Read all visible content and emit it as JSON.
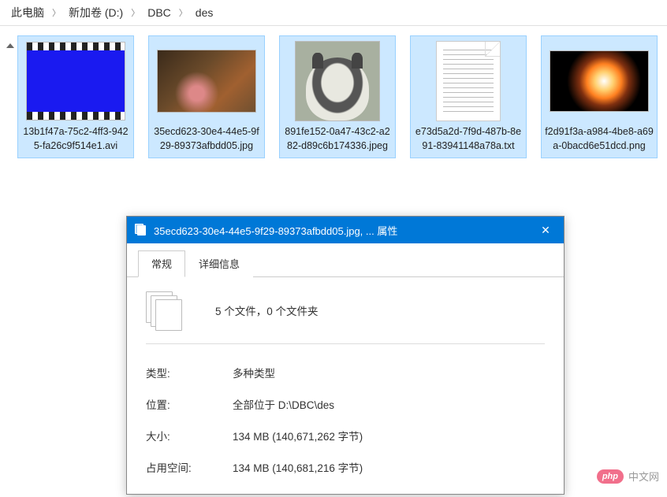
{
  "breadcrumb": {
    "items": [
      "此电脑",
      "新加卷 (D:)",
      "DBC",
      "des"
    ]
  },
  "files": [
    {
      "name": "13b1f47a-75c2-4ff3-9425-fa26c9f514e1.avi",
      "kind": "video"
    },
    {
      "name": "35ecd623-30e4-44e5-9f29-89373afbdd05.jpg",
      "kind": "image1"
    },
    {
      "name": "891fe152-0a47-43c2-a282-d89c6b174336.jpeg",
      "kind": "image2"
    },
    {
      "name": "e73d5a2d-7f9d-487b-8e91-83941148a78a.txt",
      "kind": "text"
    },
    {
      "name": "f2d91f3a-a984-4be8-a69a-0bacd6e51dcd.png",
      "kind": "png"
    }
  ],
  "dialog": {
    "title": "35ecd623-30e4-44e5-9f29-89373afbdd05.jpg, ... 属性",
    "tabs": {
      "general": "常规",
      "details": "详细信息"
    },
    "summary": "5 个文件，0 个文件夹",
    "rows": {
      "type_label": "类型:",
      "type_value": "多种类型",
      "location_label": "位置:",
      "location_value": "全部位于 D:\\DBC\\des",
      "size_label": "大小:",
      "size_value": "134 MB (140,671,262 字节)",
      "disk_label": "占用空间:",
      "disk_value": "134 MB (140,681,216 字节)"
    }
  },
  "watermark": {
    "badge": "php",
    "text": "中文网"
  }
}
